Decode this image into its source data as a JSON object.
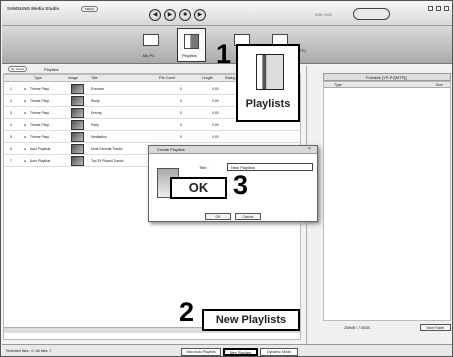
{
  "app": {
    "title": "SAMSUNG Media Studio",
    "menu": "MENU",
    "time": "0:00 / 0:00"
  },
  "nav": {
    "my_pc": "My PC",
    "playlists": "Playlists"
  },
  "toolbar": {
    "button": "My Studio",
    "title": "Playlists"
  },
  "columns": [
    "Type",
    "Image",
    "Title",
    "File Count",
    "Length",
    "Rating"
  ],
  "rows": [
    {
      "id": "1",
      "type": "Theme Playl...",
      "title": "Exercise",
      "count": "0",
      "length": "0:00"
    },
    {
      "id": "2",
      "type": "Theme Playl...",
      "title": "Study",
      "count": "0",
      "length": "0:00"
    },
    {
      "id": "3",
      "type": "Theme Playl...",
      "title": "Driving",
      "count": "0",
      "length": "0:00"
    },
    {
      "id": "4",
      "type": "Theme Playl...",
      "title": "Party",
      "count": "0",
      "length": "0:00"
    },
    {
      "id": "5",
      "type": "Theme Playl...",
      "title": "Meditation",
      "count": "0",
      "length": "0:00"
    },
    {
      "id": "6",
      "type": "Auto Playlists",
      "title": "Most Favorite Tracks",
      "count": "0",
      "length": "0:00"
    },
    {
      "id": "7",
      "type": "Auto Playlists",
      "title": "Top 25 Played Tracks",
      "count": "0",
      "length": "0:00"
    }
  ],
  "dialog": {
    "title": "Create Playlists",
    "field_label": "Title :",
    "value": "New Playlists",
    "ok": "OK",
    "cancel": "Cancel"
  },
  "callouts": {
    "playlists": "Playlists",
    "ok": "OK",
    "new_playlists": "New Playlists",
    "n1": "1",
    "n2": "2",
    "n3": "3"
  },
  "portable": {
    "title": "Portable [YP-P2[MTP]]",
    "device": "P2 [MTP]",
    "column": "Type",
    "size": "Size",
    "capacity": "255MB / 7.55GB",
    "new_folder": "New Folder"
  },
  "status": {
    "selected": "Selected lists : 0, All lists: 7",
    "new_auto": "New Auto Playlists",
    "new_playlists": "New Playlists",
    "dynamic": "Dynamic Mode"
  }
}
